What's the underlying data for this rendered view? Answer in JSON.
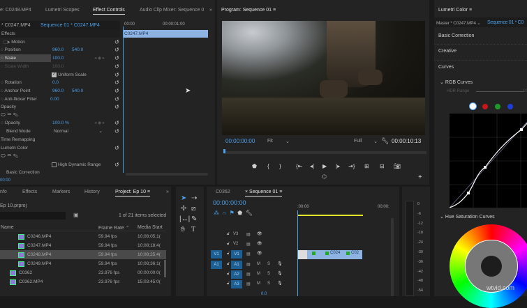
{
  "effect_controls": {
    "tabs": [
      "e: C0248.MP4",
      "Lumetri Scopes",
      "Effect Controls",
      "Audio Clip Mixer: Sequence 0",
      "»"
    ],
    "master_clip": "* C0247.MP4",
    "sequence_clip": "Sequence 01 * C0247.MP4",
    "ruler": [
      "00:00",
      "00:00:01:00"
    ],
    "timeline_clip": "C0247.MP4",
    "section": "Effects",
    "motion": "Motion",
    "position_label": "Position",
    "position_x": "960.0",
    "position_y": "540.0",
    "scale_label": "Scale",
    "scale_value": "100.0",
    "scale_width_label": "Scale Width",
    "scale_width_value": "100.0",
    "uniform_scale": "Uniform Scale",
    "rotation_label": "Rotation",
    "rotation_value": "0.0",
    "anchor_label": "Anchor Point",
    "anchor_x": "960.0",
    "anchor_y": "540.0",
    "antiflicker_label": "Anti-flicker Filter",
    "antiflicker_value": "0.00",
    "opacity_section": "Opacity",
    "opacity_label": "Opacity",
    "opacity_value": "100.0 %",
    "blend_label": "Blend Mode",
    "blend_value": "Normal",
    "time_remapping": "Time Remapping",
    "lumetri": "Lumetri Color",
    "hdr": "High Dynamic Range",
    "basic_correction": "Basic Correction",
    "timecode": "00:00"
  },
  "program": {
    "title": "Program: Sequence 01",
    "timecode": "00:00:00:00",
    "fit": "Fit",
    "quality": "Full",
    "duration": "00:00:10:13"
  },
  "lumetri": {
    "title": "Lumetri Color",
    "master": "Master * C0247.MP4",
    "sequence": "Sequence 01 * C0",
    "sections": [
      "Basic Correction",
      "Creative",
      "Curves"
    ],
    "rgb_curves": "RGB Curves",
    "hdr_range": "HDR Range",
    "hdr_value": "10",
    "hue_sat": "Hue Saturation Curves",
    "channel_colors": [
      "#ffffff",
      "#c8161b",
      "#1e9a2a",
      "#1c3fd6"
    ]
  },
  "project": {
    "tabs": [
      "nfo",
      "Effects",
      "Markers",
      "History",
      "Project: Ep 10",
      "»"
    ],
    "file": "Ep 10.prproj",
    "selection": "1 of 21 items selected",
    "columns": [
      "Name",
      "Frame Rate",
      "Media Start"
    ],
    "items": [
      {
        "name": "C0246.MP4",
        "rate": "59.94 fps",
        "start": "10;08;05;1("
      },
      {
        "name": "C0247.MP4",
        "rate": "59.94 fps",
        "start": "10;08;18;4("
      },
      {
        "name": "C0248.MP4",
        "rate": "59.94 fps",
        "start": "10;08;25;4("
      },
      {
        "name": "C0249.MP4",
        "rate": "59.94 fps",
        "start": "10;08;36;1("
      },
      {
        "name": "C0362",
        "rate": "23.976 fps",
        "start": "00:00:00:0("
      },
      {
        "name": "C0362.MP4",
        "rate": "23.976 fps",
        "start": "15:03:45:0("
      }
    ]
  },
  "timeline": {
    "tabs": [
      "C0362",
      "Sequence 01"
    ],
    "timecode": "00:00:00:00",
    "ruler": [
      ":00:00",
      "00:00:"
    ],
    "tracks": [
      "V3",
      "V2",
      "V1",
      "A1",
      "A2",
      "A3"
    ],
    "src_v": "V1",
    "src_a": "A1",
    "clips": [
      "C024",
      "C02"
    ],
    "mix_value": "0.0",
    "meter": [
      "0",
      "-6",
      "-12",
      "-18",
      "-24",
      "-30",
      "-36",
      "-42",
      "-48",
      "-54"
    ]
  },
  "watermark": "wtvid.com"
}
